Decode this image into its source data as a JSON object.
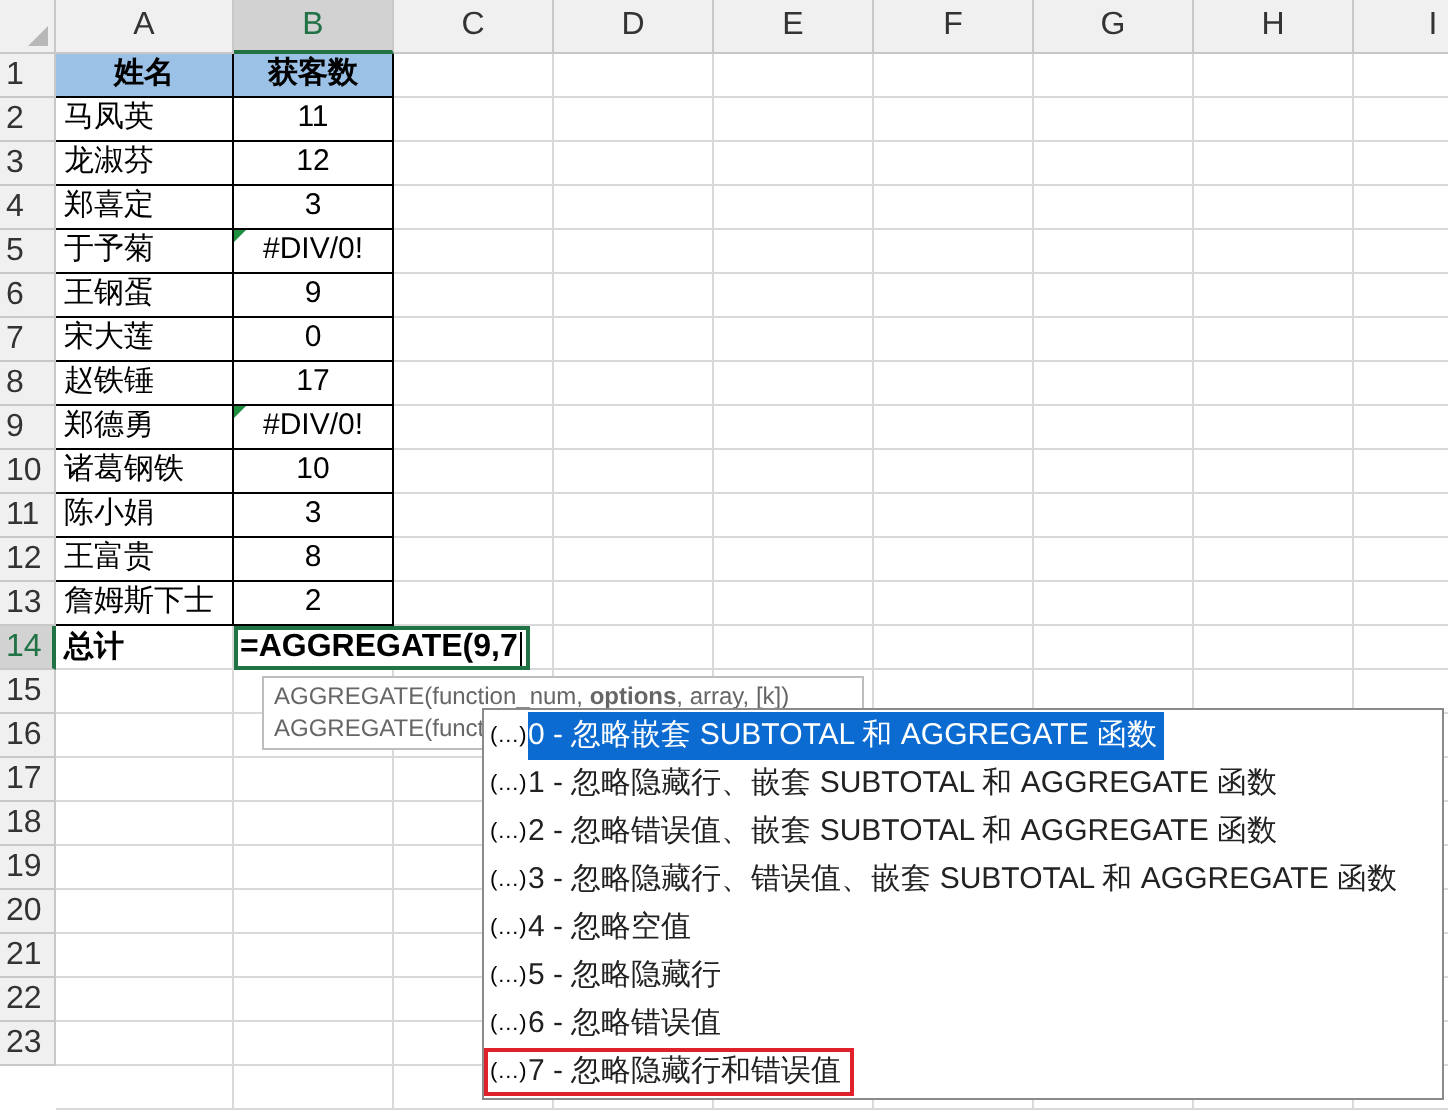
{
  "column_headers": [
    {
      "label": "A",
      "selected": false
    },
    {
      "label": "B",
      "selected": true
    },
    {
      "label": "C",
      "selected": false
    },
    {
      "label": "D",
      "selected": false
    },
    {
      "label": "E",
      "selected": false
    },
    {
      "label": "F",
      "selected": false
    },
    {
      "label": "G",
      "selected": false
    },
    {
      "label": "H",
      "selected": false
    },
    {
      "label": "I",
      "selected": false
    }
  ],
  "rows": [
    {
      "label": "1",
      "selected": false,
      "cells": [
        {
          "kind": "header",
          "text": "姓名"
        },
        {
          "kind": "header",
          "text": "获客数"
        }
      ]
    },
    {
      "label": "2",
      "selected": false,
      "cells": [
        {
          "kind": "name",
          "text": "马凤英"
        },
        {
          "kind": "number",
          "text": "11",
          "error_flag": false
        }
      ]
    },
    {
      "label": "3",
      "selected": false,
      "cells": [
        {
          "kind": "name",
          "text": "龙淑芬"
        },
        {
          "kind": "number",
          "text": "12",
          "error_flag": false
        }
      ]
    },
    {
      "label": "4",
      "selected": false,
      "cells": [
        {
          "kind": "name",
          "text": "郑喜定"
        },
        {
          "kind": "number",
          "text": "3",
          "error_flag": false
        }
      ]
    },
    {
      "label": "5",
      "selected": false,
      "cells": [
        {
          "kind": "name",
          "text": "于予菊"
        },
        {
          "kind": "number",
          "text": "#DIV/0!",
          "error_flag": true
        }
      ]
    },
    {
      "label": "6",
      "selected": false,
      "cells": [
        {
          "kind": "name",
          "text": "王钢蛋"
        },
        {
          "kind": "number",
          "text": "9",
          "error_flag": false
        }
      ]
    },
    {
      "label": "7",
      "selected": false,
      "cells": [
        {
          "kind": "name",
          "text": "宋大莲"
        },
        {
          "kind": "number",
          "text": "0",
          "error_flag": false
        }
      ]
    },
    {
      "label": "8",
      "selected": false,
      "cells": [
        {
          "kind": "name",
          "text": "赵铁锤"
        },
        {
          "kind": "number",
          "text": "17",
          "error_flag": false
        }
      ]
    },
    {
      "label": "9",
      "selected": false,
      "cells": [
        {
          "kind": "name",
          "text": "郑德勇"
        },
        {
          "kind": "number",
          "text": "#DIV/0!",
          "error_flag": true
        }
      ]
    },
    {
      "label": "10",
      "selected": false,
      "cells": [
        {
          "kind": "name",
          "text": "诸葛钢铁"
        },
        {
          "kind": "number",
          "text": "10",
          "error_flag": false
        }
      ]
    },
    {
      "label": "11",
      "selected": false,
      "cells": [
        {
          "kind": "name",
          "text": "陈小娟"
        },
        {
          "kind": "number",
          "text": "3",
          "error_flag": false
        }
      ]
    },
    {
      "label": "12",
      "selected": false,
      "cells": [
        {
          "kind": "name",
          "text": "王富贵"
        },
        {
          "kind": "number",
          "text": "8",
          "error_flag": false
        }
      ]
    },
    {
      "label": "13",
      "selected": false,
      "cells": [
        {
          "kind": "name",
          "text": "詹姆斯下士"
        },
        {
          "kind": "number",
          "text": "2",
          "error_flag": false
        }
      ]
    },
    {
      "label": "14",
      "selected": true,
      "cells": [
        {
          "kind": "total_label",
          "text": "总计"
        },
        {
          "kind": "formula",
          "text": "=AGGREGATE(9,7"
        }
      ]
    },
    {
      "label": "15",
      "selected": false
    },
    {
      "label": "16",
      "selected": false
    },
    {
      "label": "17",
      "selected": false
    },
    {
      "label": "18",
      "selected": false
    },
    {
      "label": "19",
      "selected": false
    },
    {
      "label": "20",
      "selected": false
    },
    {
      "label": "21",
      "selected": false
    },
    {
      "label": "22",
      "selected": false
    },
    {
      "label": "23",
      "selected": false
    }
  ],
  "signature_tip": {
    "lines": [
      "AGGREGATE(function_num, **options**, array, [k])",
      "AGGREGATE(funct"
    ]
  },
  "option_list": [
    {
      "icon": "(…)",
      "label": "0 - 忽略嵌套 SUBTOTAL 和 AGGREGATE 函数",
      "selected": true,
      "marked": false
    },
    {
      "icon": "(…)",
      "label": "1 - 忽略隐藏行、嵌套 SUBTOTAL 和 AGGREGATE 函数",
      "selected": false,
      "marked": false
    },
    {
      "icon": "(…)",
      "label": "2 - 忽略错误值、嵌套 SUBTOTAL 和 AGGREGATE 函数",
      "selected": false,
      "marked": false
    },
    {
      "icon": "(…)",
      "label": "3 - 忽略隐藏行、错误值、嵌套 SUBTOTAL 和 AGGREGATE 函数",
      "selected": false,
      "marked": false
    },
    {
      "icon": "(…)",
      "label": "4 - 忽略空值",
      "selected": false,
      "marked": false
    },
    {
      "icon": "(…)",
      "label": "5 - 忽略隐藏行",
      "selected": false,
      "marked": false
    },
    {
      "icon": "(…)",
      "label": "6 - 忽略错误值",
      "selected": false,
      "marked": false
    },
    {
      "icon": "(…)",
      "label": "7 - 忽略隐藏行和错误值",
      "selected": false,
      "marked": true
    }
  ]
}
